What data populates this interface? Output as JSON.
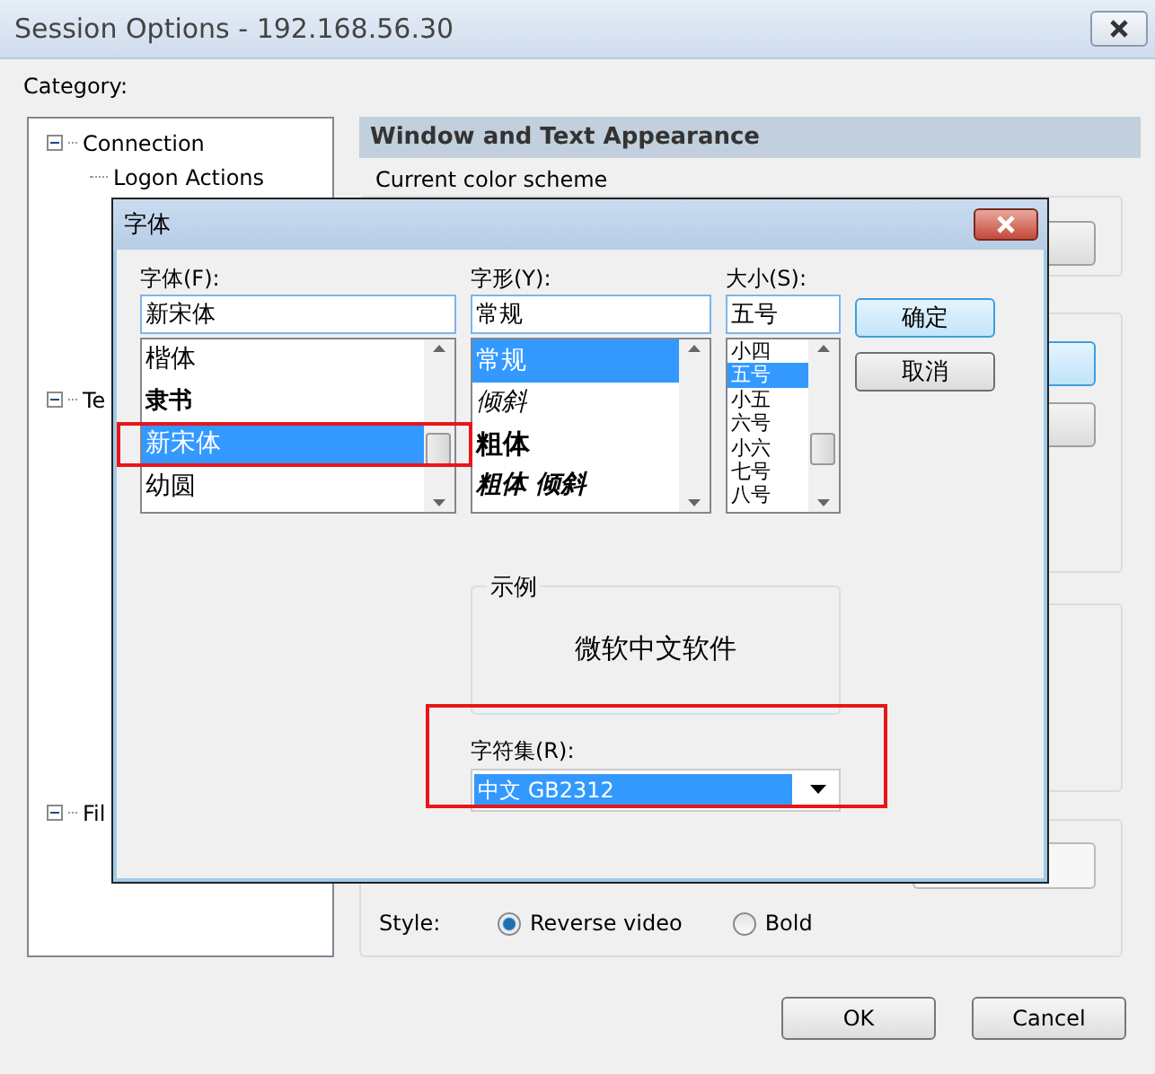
{
  "window": {
    "title": "Session Options - 192.168.56.30"
  },
  "category_label": "Category:",
  "tree": [
    {
      "label": "Connection",
      "expanded": true,
      "children": [
        {
          "label": "Logon Actions"
        }
      ]
    },
    {
      "label": "Te",
      "expanded": true
    },
    {
      "label": "Fil",
      "expanded": true
    }
  ],
  "panel": {
    "header": "Window and Text Appearance",
    "color_scheme_label": "Current color scheme",
    "style_label": "Style:",
    "style_options": [
      {
        "label": "Reverse video",
        "selected": true
      },
      {
        "label": "Bold",
        "selected": false
      }
    ]
  },
  "buttons": [
    "OK",
    "Cancel"
  ],
  "font_dialog": {
    "title": "字体",
    "font": {
      "label": "字体(F):",
      "value": "新宋体",
      "items": [
        {
          "label": "楷体",
          "selected": false,
          "highlighted": false
        },
        {
          "label": "隶书",
          "selected": false,
          "highlighted": false
        },
        {
          "label": "新宋体",
          "selected": true,
          "highlighted": true
        },
        {
          "label": "幼圆",
          "selected": false,
          "highlighted": false
        }
      ]
    },
    "style": {
      "label": "字形(Y):",
      "value": "常规",
      "items": [
        {
          "label": "常规",
          "kind": "regular",
          "selected": true
        },
        {
          "label": "倾斜",
          "kind": "italic",
          "selected": false
        },
        {
          "label": "粗体",
          "kind": "bold",
          "selected": false
        },
        {
          "label": "粗体 倾斜",
          "kind": "bolditalic",
          "selected": false
        }
      ]
    },
    "size": {
      "label": "大小(S):",
      "value": "五号",
      "items": [
        {
          "label": "小四",
          "selected": false
        },
        {
          "label": "五号",
          "selected": true
        },
        {
          "label": "小五",
          "selected": false
        },
        {
          "label": "六号",
          "selected": false
        },
        {
          "label": "小六",
          "selected": false
        },
        {
          "label": "七号",
          "selected": false
        },
        {
          "label": "八号",
          "selected": false
        }
      ]
    },
    "buttons": [
      {
        "label": "确定",
        "default": true
      },
      {
        "label": "取消",
        "default": false
      }
    ],
    "sample": {
      "label": "示例",
      "text": "微软中文软件"
    },
    "charset": {
      "label": "字符集(R):",
      "value": "中文 GB2312",
      "highlighted": true
    }
  }
}
